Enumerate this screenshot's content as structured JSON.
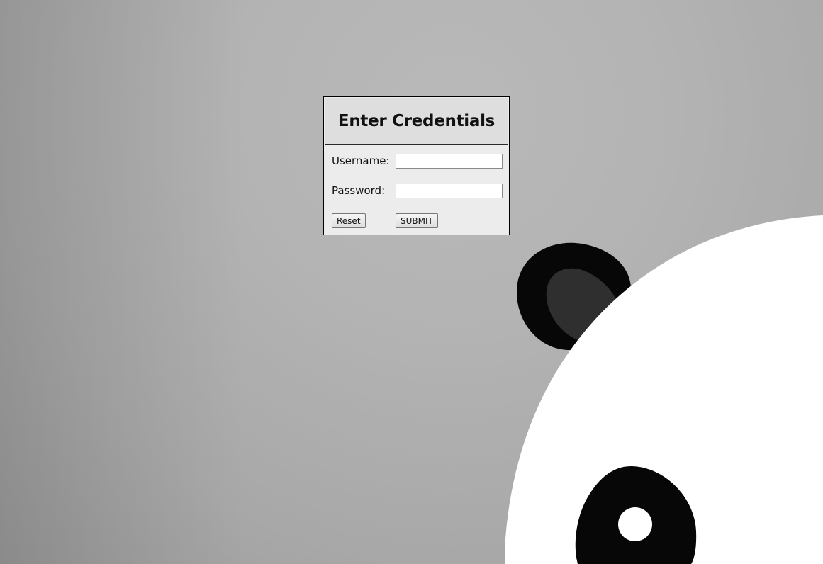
{
  "login": {
    "title": "Enter Credentials",
    "username_label": "Username:",
    "username_value": "",
    "password_label": "Password:",
    "password_value": "",
    "reset_label": "Reset",
    "submit_label": "SUBMIT"
  },
  "background": {
    "illustration": "panda-face",
    "colors": {
      "background": "#b3b3b3",
      "panda_white": "#ffffff",
      "panda_black": "#070707",
      "ear_inner": "#2f2f2f",
      "panel": "#ececec",
      "panel_header": "#dedede"
    }
  }
}
